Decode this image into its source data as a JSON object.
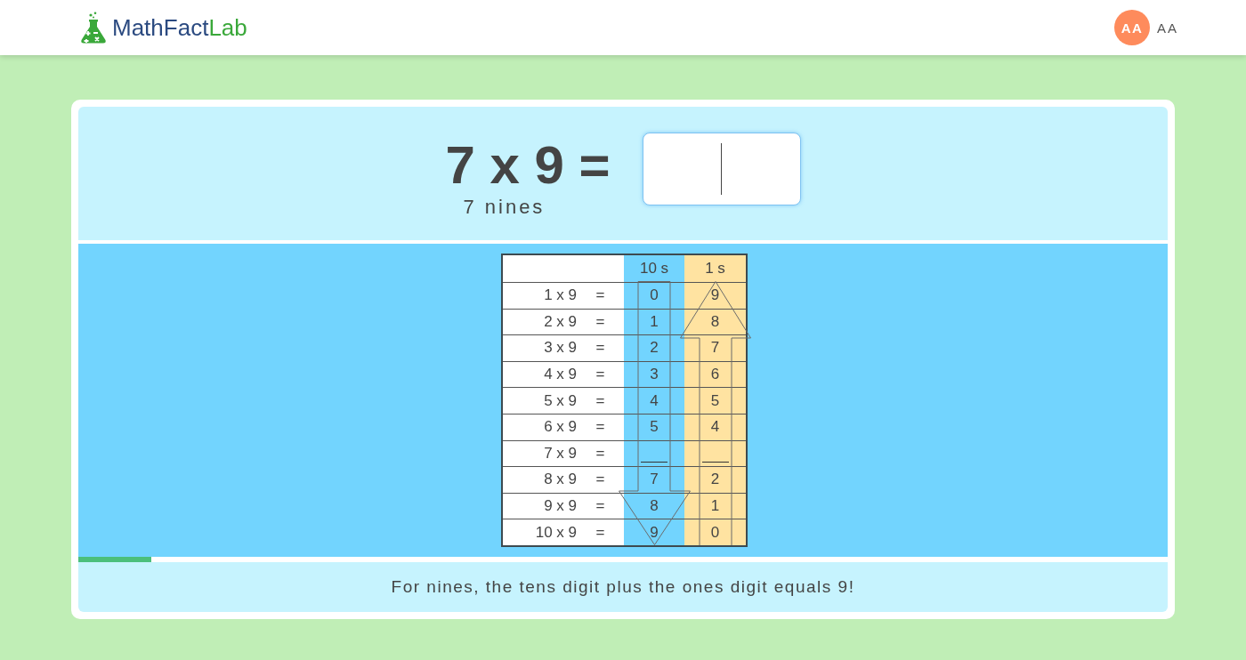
{
  "header": {
    "logo": {
      "name": "MathFact",
      "accent": "Lab"
    },
    "user": {
      "initials": "AA",
      "name": "AA"
    }
  },
  "question": {
    "prompt": "7 x 9 =",
    "caption": "7 nines",
    "answer": {
      "focused": true
    }
  },
  "table": {
    "columns": [
      "10 s",
      "1 s"
    ],
    "rows": [
      {
        "kind": "digits",
        "label": "1 x 9",
        "equals": "=",
        "tens": "0",
        "ones": "9"
      },
      {
        "kind": "digits",
        "label": "2 x 9",
        "equals": "=",
        "tens": "1",
        "ones": "8"
      },
      {
        "kind": "digits",
        "label": "3 x 9",
        "equals": "=",
        "tens": "2",
        "ones": "7"
      },
      {
        "kind": "digits",
        "label": "4 x 9",
        "equals": "=",
        "tens": "3",
        "ones": "6"
      },
      {
        "kind": "digits",
        "label": "5 x 9",
        "equals": "=",
        "tens": "4",
        "ones": "5"
      },
      {
        "kind": "digits",
        "label": "6 x 9",
        "equals": "=",
        "tens": "5",
        "ones": "4"
      },
      {
        "kind": "blank",
        "label": "7 x 9",
        "equals": "="
      },
      {
        "kind": "digits",
        "label": "8 x 9",
        "equals": "=",
        "tens": "7",
        "ones": "2"
      },
      {
        "kind": "digits",
        "label": "9 x 9",
        "equals": "=",
        "tens": "8",
        "ones": "1"
      },
      {
        "kind": "digits",
        "label": "10 x 9",
        "equals": "=",
        "tens": "9",
        "ones": "0"
      }
    ]
  },
  "progress": {
    "level": 0.067
  },
  "tip": "For nines, the tens digit plus the ones digit equals 9!"
}
